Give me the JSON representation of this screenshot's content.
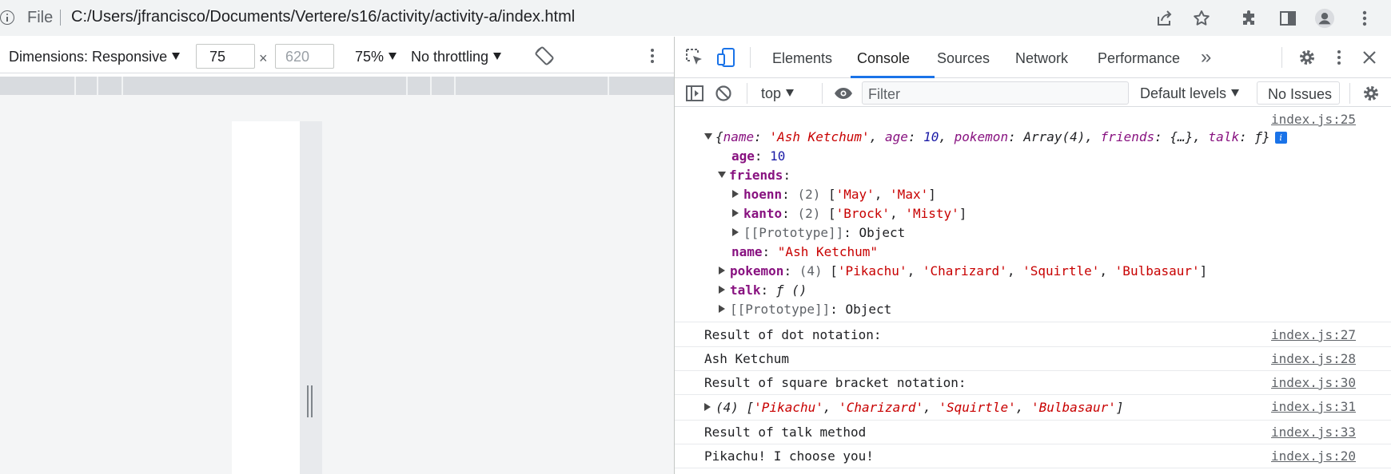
{
  "address_bar": {
    "scheme_label": "File",
    "url": "C:/Users/jfrancisco/Documents/Vertere/s16/activity/activity-a/index.html",
    "icons": [
      "info-icon",
      "share-icon",
      "bookmark-star-icon",
      "extensions-icon",
      "side-panel-icon",
      "profile-icon",
      "menu-icon"
    ]
  },
  "device_toolbar": {
    "dimensions_label": "Dimensions: Responsive",
    "width_value": "75",
    "times": "×",
    "height_placeholder": "620",
    "zoom": "75%",
    "throttling": "No throttling"
  },
  "devtools": {
    "tabs": [
      {
        "label": "Elements"
      },
      {
        "label": "Console"
      },
      {
        "label": "Sources"
      },
      {
        "label": "Network"
      },
      {
        "label": "Performance"
      }
    ],
    "more_tabs": "»",
    "active_tab": "Console",
    "context": "top",
    "filter_placeholder": "Filter",
    "levels": "Default levels",
    "issues": "No Issues"
  },
  "console": {
    "object_log": {
      "source": "index.js:25",
      "preview": {
        "open": "{",
        "name_key": "name",
        "name_val": "'Ash Ketchum'",
        "age_key": "age",
        "age_val": "10",
        "pokemon_key": "pokemon",
        "pokemon_val": "Array(4)",
        "friends_key": "friends",
        "friends_val": "{…}",
        "talk_key": "talk",
        "talk_val": "ƒ",
        "close": "}",
        "badge": "i"
      },
      "age": {
        "key": "age",
        "value": "10"
      },
      "friends": {
        "key": "friends",
        "hoenn": {
          "key": "hoenn",
          "count": "(2)",
          "items": [
            "'May'",
            "'Max'"
          ]
        },
        "kanto": {
          "key": "kanto",
          "count": "(2)",
          "items": [
            "'Brock'",
            "'Misty'"
          ]
        },
        "prototype": {
          "key": "[[Prototype]]",
          "value": "Object"
        }
      },
      "name": {
        "key": "name",
        "value": "\"Ash Ketchum\""
      },
      "pokemon": {
        "key": "pokemon",
        "count": "(4)",
        "items": [
          "'Pikachu'",
          "'Charizard'",
          "'Squirtle'",
          "'Bulbasaur'"
        ]
      },
      "talk": {
        "key": "talk",
        "value": "ƒ ()"
      },
      "prototype": {
        "key": "[[Prototype]]",
        "value": "Object"
      }
    },
    "messages": [
      {
        "text": "Result of dot notation:",
        "source": "index.js:27"
      },
      {
        "text": "Ash Ketchum",
        "source": "index.js:28"
      },
      {
        "text": "Result of square bracket notation:",
        "source": "index.js:30"
      },
      {
        "count": "(4)",
        "items": [
          "'Pikachu'",
          "'Charizard'",
          "'Squirtle'",
          "'Bulbasaur'"
        ],
        "source": "index.js:31"
      },
      {
        "text": "Result of talk method",
        "source": "index.js:33"
      },
      {
        "text": "Pikachu! I choose you!",
        "source": "index.js:20"
      }
    ]
  }
}
